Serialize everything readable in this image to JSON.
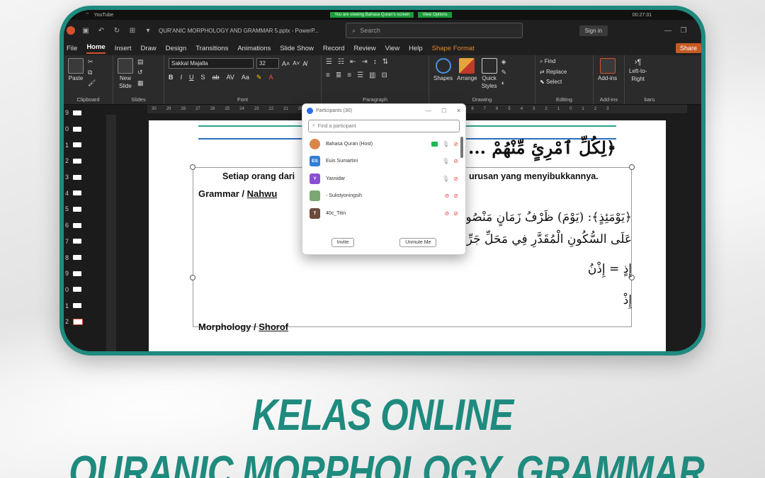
{
  "taskbar": {
    "app": "YouTube",
    "zoom_banner": "You are viewing Bahasa Quran's screen",
    "zoom_options": "View Options",
    "timer": "00:27:31"
  },
  "window": {
    "title": "QUR'ANIC MORPHOLOGY AND GRAMMAR 5.pptx - PowerP...",
    "search_placeholder": "Search",
    "signin_label": "Sign in"
  },
  "menu": {
    "tabs": [
      "File",
      "Home",
      "Insert",
      "Draw",
      "Design",
      "Transitions",
      "Animations",
      "Slide Show",
      "Record",
      "Review",
      "View",
      "Help",
      "Shape Format"
    ],
    "share_label": "Share"
  },
  "ribbon": {
    "paste": "Paste",
    "clipboard": "Clipboard",
    "new_slide_1": "New",
    "new_slide_2": "Slide",
    "slides": "Slides",
    "font_name": "Sakkal Majalla",
    "font_size": "32",
    "font": "Font",
    "paragraph": "Paragraph",
    "shapes": "Shapes",
    "arrange": "Arrange",
    "quick_styles_1": "Quick",
    "quick_styles_2": "Styles",
    "drawing": "Drawing",
    "find": "Find",
    "replace": "Replace",
    "select": "Select",
    "editing": "Editing",
    "addins": "Add-ins",
    "addins_group": "Add-ins",
    "ltr_1": "Left-to-",
    "ltr_2": "Right",
    "baru": "baru"
  },
  "thumbnails": [
    "9",
    "0",
    "1",
    "2",
    "3",
    "4",
    "5",
    "6",
    "7",
    "8",
    "9",
    "0",
    "1",
    "2"
  ],
  "ruler": {
    "h_ticks": [
      "30",
      "29",
      "28",
      "27",
      "26",
      "25",
      "24",
      "23",
      "22",
      "21",
      "20",
      "19",
      "18",
      "17",
      "16",
      "15",
      "14",
      "13",
      "12",
      "11",
      "10",
      "9",
      "8",
      "7",
      "6",
      "5",
      "4",
      "3",
      "2",
      "1",
      "0",
      "1",
      "2",
      "3"
    ]
  },
  "slide": {
    "ayah": "﴿لِكُلِّ ٱمْرِئٍ مِّنْهُمْ ... ﴾ [عبس ٣٧]",
    "translation_left": "Setiap orang dari",
    "translation_right": "urusan yang menyibukkannya.",
    "grammar_label": "Grammar / ",
    "grammar_underlined": "Nahwu",
    "arabic_line1": "﴿يَوْمَئِذٍ﴾: (يَوْمَ) ظَرْفُ زَمَانٍ مَنْصُوبٌ ... وَ(إِذْ) اسْمٌ ظَرْفِيٌّ مَبْنِيٌّ",
    "arabic_line2": "عَلَى السُّكُونِ الْمُقَدَّرِ فِي مَحَلِّ جَرِّ مُ... لَةِ مَحْذُوفَةٍ.",
    "arabic_line3": "إِذٍ = إِذْنُ",
    "arabic_line4": "إِذْ",
    "morph_label": "Morphology / ",
    "morph_underlined": "Shorof"
  },
  "participants": {
    "title": "Participants (30)",
    "find_placeholder": "Find a participant",
    "list": [
      {
        "name": "Bahasa Quran (Host)",
        "initials": "",
        "color": "#d9874a"
      },
      {
        "name": "Euis Sumartini",
        "initials": "ES",
        "color": "#2f7fd8"
      },
      {
        "name": "Yasnidar",
        "initials": "Y",
        "color": "#8a4fd1"
      },
      {
        "name": "- Sulistyoningsih",
        "initials": "",
        "color": "#7aa870"
      },
      {
        "name": "40c_Titin",
        "initials": "T",
        "color": "#6b4a3a"
      }
    ],
    "invite": "Invite",
    "unmute_me": "Unmute Me"
  },
  "headline": {
    "line1": "KELAS ONLINE",
    "line2": "QURANIC MORPHOLOGY, GRAMMAR"
  },
  "colors": {
    "brand_teal": "#1f8a7e",
    "ppt_accent": "#d35230"
  }
}
